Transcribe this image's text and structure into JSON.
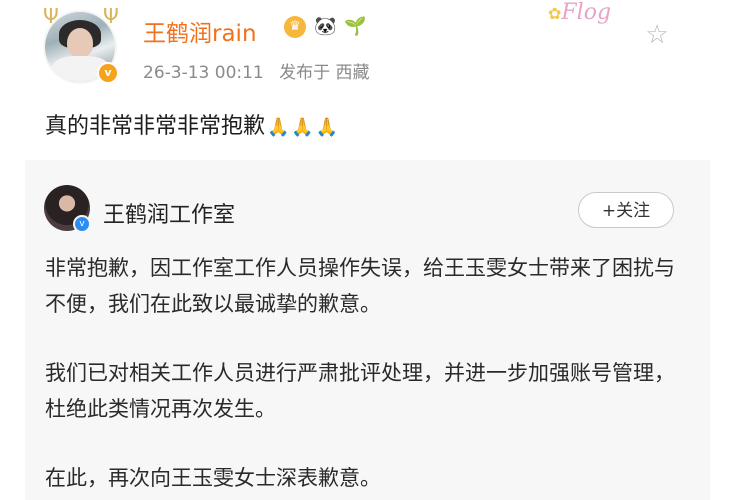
{
  "post": {
    "username": "王鹤润rain",
    "timestamp": "26-3-13 00:11",
    "location": "发布于 西藏",
    "text": "真的非常非常非常抱歉",
    "sticker_text": "Flog",
    "icons": {
      "star": "star-outline-icon",
      "vip": "crown-icon",
      "panda": "panda-icon",
      "sprout": "sprout-icon",
      "verified": "verified-badge-icon"
    }
  },
  "repost": {
    "account_name": "王鹤润工作室",
    "follow_label": "+关注",
    "paragraphs": [
      "非常抱歉，因工作室工作人员操作失误，给王玉雯女士带来了困扰与不便，我们在此致以最诚挚的歉意。",
      "我们已对相关工作人员进行严肃批评处理，并进一步加强账号管理，杜绝此类情况再次发生。",
      "在此，再次向王玉雯女士深表歉意。"
    ]
  },
  "colors": {
    "username": "#f2711c",
    "meta": "#8a8a8a",
    "card_bg": "#f7f7f7",
    "verified_orange": "#f7a21b",
    "verified_blue": "#2d8cf0"
  }
}
